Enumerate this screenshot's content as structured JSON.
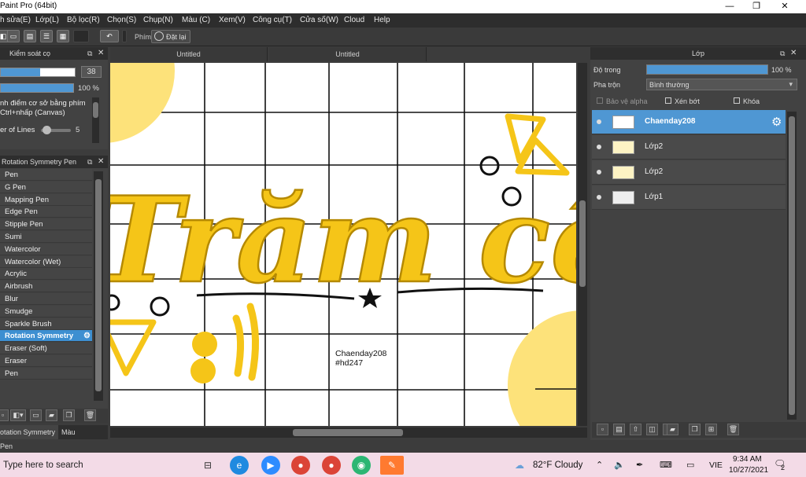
{
  "window": {
    "title": "Paint Pro (64bit)",
    "minimize": "—",
    "restore": "❐",
    "close": "✕"
  },
  "menu": [
    "h sửa(E)",
    "Lớp(L)",
    "Bộ lọc(R)",
    "Chọn(S)",
    "Chụp(N)",
    "Màu (C)",
    "Xem(V)",
    "Công cụ(T)",
    "Cửa số(W)",
    "Cloud",
    "Help"
  ],
  "toolbar": {
    "phim_label": "Phím",
    "dat_lai_label": "Đặt lại"
  },
  "tool_property": {
    "title": "Kiểm soát cọ",
    "size_value": "38",
    "opacity_value": "100 %",
    "option_line1": "nh điểm cơ sở bằng phím",
    "option_line2": "Ctrl+nhấp (Canvas)",
    "lines_label": "er of Lines",
    "lines_value": "5"
  },
  "brush_panel": {
    "title": "Rotation Symmetry Pen",
    "items": [
      "Pen",
      "G Pen",
      "Mapping Pen",
      "Edge Pen",
      "Stipple Pen",
      "Sumi",
      "Watercolor",
      "Watercolor (Wet)",
      "Acrylic",
      "Airbrush",
      "Blur",
      "Smudge",
      "Sparkle Brush",
      "Rotation Symmetry",
      "Eraser (Soft)",
      "Eraser",
      "Pen"
    ],
    "selected_index": 13,
    "tab1": "otation Symmetry Pen",
    "tab2": "Màu"
  },
  "canvas": {
    "tab1": "Untitled",
    "tab2": "Untitled",
    "credit_line1": "Chaenday208",
    "credit_line2": "#hd247",
    "lettering": "Trăm cêm",
    "accent_color": "#f5c518"
  },
  "layer_panel": {
    "title": "Lớp",
    "opacity_label": "Độ trong",
    "opacity_value": "100 %",
    "blend_label": "Pha trộn",
    "blend_value": "Bình thường",
    "protect_alpha": "Bảo vệ alpha",
    "clipping": "Xén bớt",
    "lock": "Khóa",
    "layers": [
      {
        "name": "Chaenday208",
        "selected": true
      },
      {
        "name": "Lớp2",
        "selected": false
      },
      {
        "name": "Lớp2",
        "selected": false
      },
      {
        "name": "Lớp1",
        "selected": false
      }
    ]
  },
  "taskbar": {
    "search_placeholder": "Type here to search",
    "weather": "82°F  Cloudy",
    "lang": "VIE",
    "time": "9:34 AM",
    "date": "10/27/2021",
    "notif_count": "2"
  }
}
